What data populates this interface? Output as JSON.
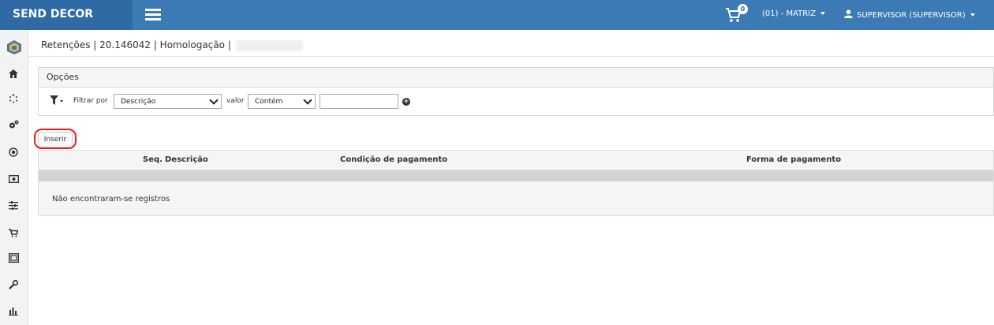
{
  "header": {
    "brand": "SEND DECOR",
    "cart_count": "0",
    "branch": "(01) - MATRIZ",
    "user": "SUPERVISOR (SUPERVISOR)"
  },
  "sidebar": {
    "items": [
      "logo-icon",
      "home-icon",
      "spinner-icon",
      "cogs-icon",
      "target-icon",
      "money-icon",
      "sliders-icon",
      "cart-icon",
      "frame-icon",
      "wrench-icon",
      "chart-icon"
    ]
  },
  "breadcrumb": {
    "text": "Retenções | 20.146042 | Homologação |"
  },
  "options": {
    "title": "Opções",
    "filter_label": "Filtrar por",
    "filter_field": "Descrição",
    "value_label": "valor",
    "operator": "Contém",
    "value_input": ""
  },
  "actions": {
    "insert_label": "Inserir"
  },
  "table": {
    "columns": [
      "Seq.",
      "Descrição",
      "Condição de pagamento",
      "Forma de pagamento"
    ],
    "empty_message": "Não encontraram-se registros"
  },
  "colors": {
    "topbar": "#3c7ab6",
    "brand_bg": "#2f6aa5",
    "highlight": "#e02020"
  }
}
